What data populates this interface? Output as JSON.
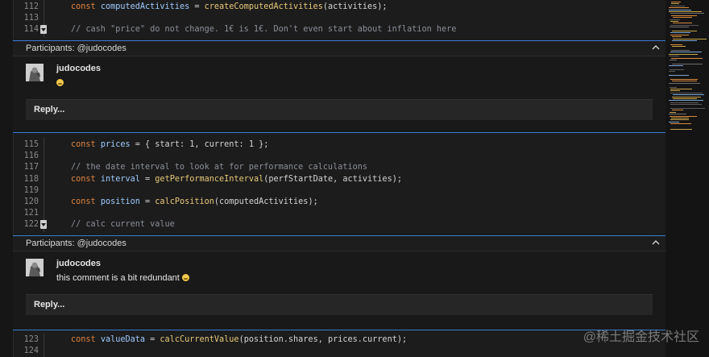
{
  "code_block_1": {
    "lines": [
      {
        "num": "112",
        "parts": [
          [
            "kw",
            "const "
          ],
          [
            "var",
            "computedActivities"
          ],
          [
            "txt",
            " = "
          ],
          [
            "fn",
            "createComputedActivities"
          ],
          [
            "txt",
            "(activities);"
          ]
        ]
      },
      {
        "num": "113",
        "parts": []
      },
      {
        "num": "114",
        "parts": [
          [
            "cm",
            "// cash \"price\" do not change. 1€ is 1€. Don't even start about inflation here"
          ]
        ],
        "marker": true
      }
    ]
  },
  "thread_1": {
    "participants": "Participants: @judocodes",
    "author": "judocodes",
    "body": "",
    "emoji": "smile-emoji",
    "reply_label": "Reply..."
  },
  "code_block_2": {
    "lines": [
      {
        "num": "115",
        "parts": [
          [
            "kw",
            "const "
          ],
          [
            "var",
            "prices"
          ],
          [
            "txt",
            " = { start: 1, current: 1 };"
          ]
        ]
      },
      {
        "num": "116",
        "parts": []
      },
      {
        "num": "117",
        "parts": [
          [
            "cm",
            "// the date interval to look at for performance calculations"
          ]
        ]
      },
      {
        "num": "118",
        "parts": [
          [
            "kw",
            "const "
          ],
          [
            "var",
            "interval"
          ],
          [
            "txt",
            " = "
          ],
          [
            "fn",
            "getPerformanceInterval"
          ],
          [
            "txt",
            "(perfStartDate, activities);"
          ]
        ]
      },
      {
        "num": "119",
        "parts": []
      },
      {
        "num": "120",
        "parts": [
          [
            "kw",
            "const "
          ],
          [
            "var",
            "position"
          ],
          [
            "txt",
            " = "
          ],
          [
            "fn",
            "calcPosition"
          ],
          [
            "txt",
            "(computedActivities);"
          ]
        ]
      },
      {
        "num": "121",
        "parts": []
      },
      {
        "num": "122",
        "parts": [
          [
            "cm",
            "// calc current value"
          ]
        ],
        "marker": true
      }
    ]
  },
  "thread_2": {
    "participants": "Participants: @judocodes",
    "author": "judocodes",
    "body": "this comment is a bit redundant",
    "emoji": "grin-emoji",
    "reply_label": "Reply..."
  },
  "code_block_3": {
    "lines": [
      {
        "num": "123",
        "parts": [
          [
            "kw",
            "const "
          ],
          [
            "var",
            "valueData"
          ],
          [
            "txt",
            " = "
          ],
          [
            "fn",
            "calcCurrentValue"
          ],
          [
            "txt",
            "(position.shares, prices.current);"
          ]
        ]
      },
      {
        "num": "124",
        "parts": []
      }
    ]
  },
  "watermark": "@稀土掘金技术社区",
  "colors": {
    "accent": "#3a7bd5",
    "keyword": "#e0843f",
    "variable": "#9ecbff",
    "function": "#e8c97a",
    "comment": "#8a8f98"
  }
}
